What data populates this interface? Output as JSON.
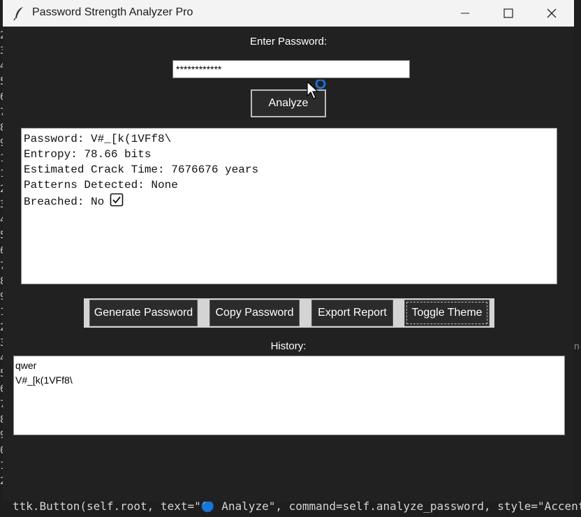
{
  "window": {
    "title": "Password Strength Analyzer Pro"
  },
  "form": {
    "enter_label": "Enter Password:",
    "password_masked": "************",
    "analyze_label": "Analyze"
  },
  "results": {
    "lines": [
      "Password: V#_[k(1VFf8\\",
      "Entropy: 78.66 bits",
      "Estimated Crack Time: 7676676 years",
      "Patterns Detected: None",
      "Breached: No"
    ]
  },
  "buttons": {
    "generate": "Generate Password",
    "copy": "Copy Password",
    "export": "Export Report",
    "toggle": "Toggle Theme"
  },
  "history": {
    "label": "History:",
    "items": [
      "qwer",
      "V#_[k(1VFf8\\"
    ]
  },
  "background": {
    "code_line": "ttk.Button(self.root, text=\"🔵 Analyze\", command=self.analyze_password, style=\"Accent",
    "gutter": [
      "2",
      "3",
      "4",
      "5",
      "6",
      "7",
      "8",
      "9",
      "1",
      "1",
      "2",
      "3",
      "4",
      "5",
      "6",
      "7",
      "8",
      "9",
      "1",
      "2",
      "3",
      "4",
      "5",
      "6",
      "7",
      "8",
      "9",
      "0",
      "1",
      "2"
    ]
  }
}
